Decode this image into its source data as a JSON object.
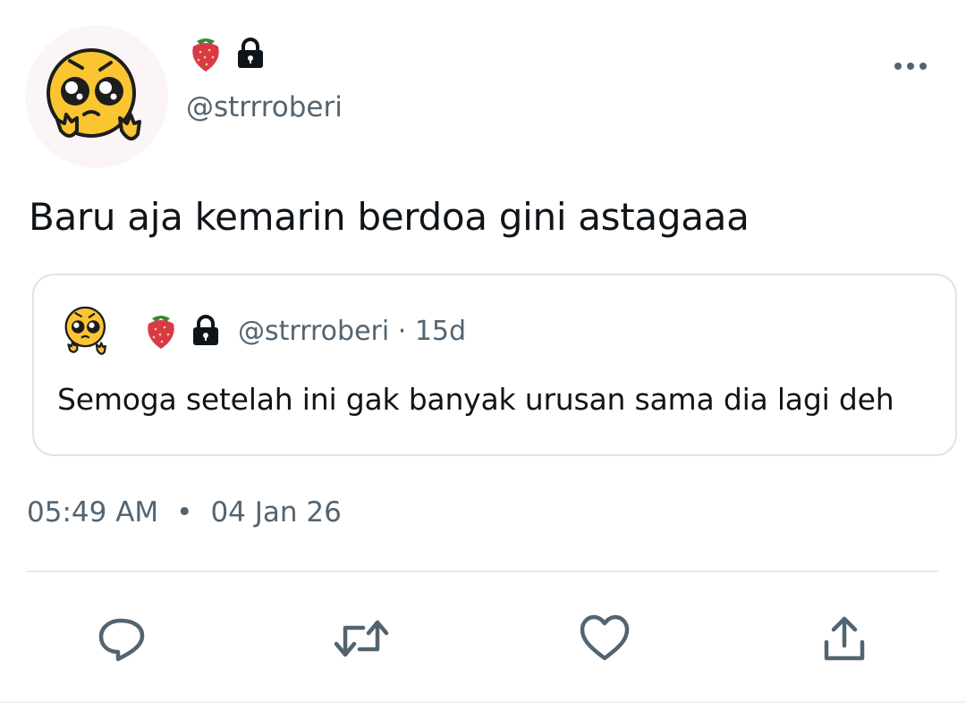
{
  "tweet": {
    "author": {
      "emoji_icon": "strawberry-icon",
      "lock_icon": "lock-icon",
      "handle": "@strrroberi",
      "avatar_icon": "pleading-emoji-avatar"
    },
    "text": "Baru aja kemarin berdoa gini astagaaa",
    "more_icon": "more-options-icon",
    "quoted": {
      "handle": "@strrroberi",
      "separator": " · ",
      "age": "15d",
      "text": "Semoga setelah ini gak banyak urusan sama dia lagi deh"
    },
    "time": "05:49 AM",
    "date": "04 Jan 26",
    "meta_separator": "•"
  },
  "actions": [
    {
      "name": "reply",
      "icon": "reply-icon"
    },
    {
      "name": "retweet",
      "icon": "retweet-icon"
    },
    {
      "name": "like",
      "icon": "heart-icon"
    },
    {
      "name": "share",
      "icon": "share-icon"
    }
  ],
  "colors": {
    "text": "#0f1419",
    "secondary": "#536471",
    "border": "#dfe3e8",
    "avatar_yellow": "#fbc531",
    "strawberry": "#d93a4a"
  }
}
